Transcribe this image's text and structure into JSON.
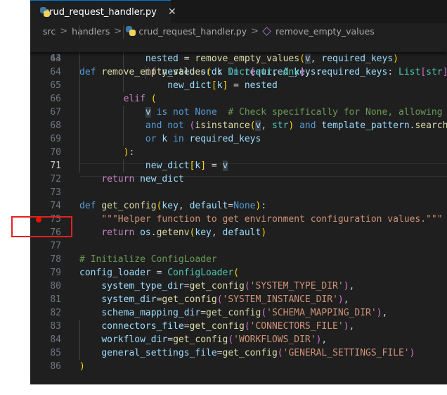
{
  "tab": {
    "filename": "crud_request_handler.py",
    "close": "✕"
  },
  "breadcrumb": {
    "root": "src",
    "folder": "handlers",
    "file": "crud_request_handler.py",
    "symbol": "remove_empty_values",
    "sep": ">"
  },
  "sticky": {
    "ln": "44",
    "def": "def ",
    "fn": "remove_empty_values",
    "rest": [
      {
        "t": "(",
        "c": "br"
      },
      {
        "t": "d",
        "c": "vr"
      },
      {
        "t": ": ",
        "c": ""
      },
      {
        "t": "Dict",
        "c": "ty"
      },
      {
        "t": "[",
        "c": "br2"
      },
      {
        "t": "str",
        "c": "ty"
      },
      {
        "t": ", ",
        "c": ""
      },
      {
        "t": "Any",
        "c": "ty"
      },
      {
        "t": "]",
        "c": "br2"
      },
      {
        "t": ", ",
        "c": ""
      },
      {
        "t": "required_keys",
        "c": "vr"
      },
      {
        "t": ": ",
        "c": ""
      },
      {
        "t": "List",
        "c": "ty"
      },
      {
        "t": "[",
        "c": "br2"
      },
      {
        "t": "str",
        "c": "ty"
      },
      {
        "t": "])",
        "c": "br2"
      }
    ]
  },
  "lines": [
    {
      "n": "63",
      "tokens": [
        {
          "t": "            nested ",
          "c": "vr"
        },
        {
          "t": "= ",
          "c": ""
        },
        {
          "t": "remove_empty_values",
          "c": "fn"
        },
        {
          "t": "(",
          "c": "br"
        },
        {
          "t": "v",
          "c": "vr hl"
        },
        {
          "t": ", ",
          "c": ""
        },
        {
          "t": "required_keys",
          "c": "vr"
        },
        {
          "t": ")",
          "c": "br"
        }
      ]
    },
    {
      "n": "64",
      "tokens": [
        {
          "t": "            ",
          "c": ""
        },
        {
          "t": "if ",
          "c": "ct"
        },
        {
          "t": "nested ",
          "c": "vr"
        },
        {
          "t": "or ",
          "c": "kw"
        },
        {
          "t": "k ",
          "c": "vr"
        },
        {
          "t": "in ",
          "c": "kw"
        },
        {
          "t": "required_keys",
          "c": "vr"
        },
        {
          "t": ":",
          "c": ""
        }
      ]
    },
    {
      "n": "65",
      "tokens": [
        {
          "t": "                ",
          "c": ""
        },
        {
          "t": "new_dict",
          "c": "vr"
        },
        {
          "t": "[",
          "c": "br"
        },
        {
          "t": "k",
          "c": "vr"
        },
        {
          "t": "] ",
          "c": "br"
        },
        {
          "t": "= ",
          "c": ""
        },
        {
          "t": "nested",
          "c": "vr"
        }
      ]
    },
    {
      "n": "66",
      "tokens": [
        {
          "t": "        ",
          "c": ""
        },
        {
          "t": "elif ",
          "c": "ct"
        },
        {
          "t": "(",
          "c": "br"
        }
      ]
    },
    {
      "n": "67",
      "tokens": [
        {
          "t": "            ",
          "c": ""
        },
        {
          "t": "v",
          "c": "vr hl"
        },
        {
          "t": " is not ",
          "c": "kw"
        },
        {
          "t": "None",
          "c": "kw"
        },
        {
          "t": "  # Check specifically for None, allowing T",
          "c": "cm"
        }
      ]
    },
    {
      "n": "68",
      "tokens": [
        {
          "t": "            ",
          "c": ""
        },
        {
          "t": "and not ",
          "c": "kw"
        },
        {
          "t": "(",
          "c": "br2"
        },
        {
          "t": "isinstance",
          "c": "fn"
        },
        {
          "t": "(",
          "c": "br"
        },
        {
          "t": "v",
          "c": "vr hl"
        },
        {
          "t": ", ",
          "c": ""
        },
        {
          "t": "str",
          "c": "ty"
        },
        {
          "t": ") ",
          "c": "br"
        },
        {
          "t": "and ",
          "c": "kw"
        },
        {
          "t": "template_pattern",
          "c": "vr"
        },
        {
          "t": ".",
          "c": ""
        },
        {
          "t": "search",
          "c": "fn"
        },
        {
          "t": "(",
          "c": "br"
        }
      ]
    },
    {
      "n": "69",
      "tokens": [
        {
          "t": "            ",
          "c": ""
        },
        {
          "t": "or ",
          "c": "kw"
        },
        {
          "t": "k ",
          "c": "vr"
        },
        {
          "t": "in ",
          "c": "kw"
        },
        {
          "t": "required_keys",
          "c": "vr"
        }
      ]
    },
    {
      "n": "70",
      "tokens": [
        {
          "t": "        ",
          "c": ""
        },
        {
          "t": ")",
          "c": "br"
        },
        {
          "t": ":",
          "c": ""
        }
      ]
    },
    {
      "n": "71",
      "active": true,
      "tokens": [
        {
          "t": "            ",
          "c": ""
        },
        {
          "t": "new_dict",
          "c": "vr"
        },
        {
          "t": "[",
          "c": "br"
        },
        {
          "t": "k",
          "c": "vr"
        },
        {
          "t": "] ",
          "c": "br"
        },
        {
          "t": "= ",
          "c": ""
        },
        {
          "t": "v",
          "c": "vr hl"
        }
      ]
    },
    {
      "n": "72",
      "tokens": [
        {
          "t": "    ",
          "c": ""
        },
        {
          "t": "return ",
          "c": "ct"
        },
        {
          "t": "new_dict",
          "c": "vr"
        }
      ]
    },
    {
      "n": "73",
      "tokens": []
    },
    {
      "n": "74",
      "tokens": [
        {
          "t": "def ",
          "c": "kw"
        },
        {
          "t": "get_config",
          "c": "fn"
        },
        {
          "t": "(",
          "c": "br"
        },
        {
          "t": "key",
          "c": "vr"
        },
        {
          "t": ", ",
          "c": ""
        },
        {
          "t": "default",
          "c": "vr"
        },
        {
          "t": "=",
          "c": ""
        },
        {
          "t": "None",
          "c": "kw"
        },
        {
          "t": ")",
          "c": "br"
        },
        {
          "t": ":",
          "c": ""
        }
      ]
    },
    {
      "n": "75",
      "breakpoint": true,
      "tokens": [
        {
          "t": "    ",
          "c": ""
        },
        {
          "t": "\"\"\"Helper function to get environment configuration values.\"\"\"",
          "c": "st"
        }
      ]
    },
    {
      "n": "76",
      "tokens": [
        {
          "t": "    ",
          "c": ""
        },
        {
          "t": "return ",
          "c": "ct"
        },
        {
          "t": "os",
          "c": "vr"
        },
        {
          "t": ".",
          "c": ""
        },
        {
          "t": "getenv",
          "c": "fn"
        },
        {
          "t": "(",
          "c": "br"
        },
        {
          "t": "key",
          "c": "vr"
        },
        {
          "t": ", ",
          "c": ""
        },
        {
          "t": "default",
          "c": "vr"
        },
        {
          "t": ")",
          "c": "br"
        }
      ]
    },
    {
      "n": "77",
      "tokens": []
    },
    {
      "n": "78",
      "tokens": [
        {
          "t": "# Initialize ConfigLoader",
          "c": "cm"
        }
      ]
    },
    {
      "n": "79",
      "tokens": [
        {
          "t": "config_loader ",
          "c": "vr"
        },
        {
          "t": "= ",
          "c": ""
        },
        {
          "t": "ConfigLoader",
          "c": "ty"
        },
        {
          "t": "(",
          "c": "br"
        }
      ]
    },
    {
      "n": "80",
      "tokens": [
        {
          "t": "    ",
          "c": ""
        },
        {
          "t": "system_type_dir",
          "c": "vr"
        },
        {
          "t": "=",
          "c": ""
        },
        {
          "t": "get_config",
          "c": "fn"
        },
        {
          "t": "(",
          "c": "br2"
        },
        {
          "t": "'SYSTEM_TYPE_DIR'",
          "c": "st"
        },
        {
          "t": ")",
          "c": "br2"
        },
        {
          "t": ",",
          "c": ""
        }
      ]
    },
    {
      "n": "81",
      "tokens": [
        {
          "t": "    ",
          "c": ""
        },
        {
          "t": "system_dir",
          "c": "vr"
        },
        {
          "t": "=",
          "c": ""
        },
        {
          "t": "get_config",
          "c": "fn"
        },
        {
          "t": "(",
          "c": "br2"
        },
        {
          "t": "'SYSTEM_INSTANCE_DIR'",
          "c": "st"
        },
        {
          "t": ")",
          "c": "br2"
        },
        {
          "t": ",",
          "c": ""
        }
      ]
    },
    {
      "n": "82",
      "tokens": [
        {
          "t": "    ",
          "c": ""
        },
        {
          "t": "schema_mapping_dir",
          "c": "vr"
        },
        {
          "t": "=",
          "c": ""
        },
        {
          "t": "get_config",
          "c": "fn"
        },
        {
          "t": "(",
          "c": "br2"
        },
        {
          "t": "'SCHEMA_MAPPING_DIR'",
          "c": "st"
        },
        {
          "t": ")",
          "c": "br2"
        },
        {
          "t": ",",
          "c": ""
        }
      ]
    },
    {
      "n": "83",
      "tokens": [
        {
          "t": "    ",
          "c": ""
        },
        {
          "t": "connectors_file",
          "c": "vr"
        },
        {
          "t": "=",
          "c": ""
        },
        {
          "t": "get_config",
          "c": "fn"
        },
        {
          "t": "(",
          "c": "br2"
        },
        {
          "t": "'CONNECTORS_FILE'",
          "c": "st"
        },
        {
          "t": ")",
          "c": "br2"
        },
        {
          "t": ",",
          "c": ""
        }
      ]
    },
    {
      "n": "84",
      "tokens": [
        {
          "t": "    ",
          "c": ""
        },
        {
          "t": "workflow_dir",
          "c": "vr"
        },
        {
          "t": "=",
          "c": ""
        },
        {
          "t": "get_config",
          "c": "fn"
        },
        {
          "t": "(",
          "c": "br2"
        },
        {
          "t": "'WORKFLOWS_DIR'",
          "c": "st"
        },
        {
          "t": ")",
          "c": "br2"
        },
        {
          "t": ",",
          "c": ""
        }
      ]
    },
    {
      "n": "85",
      "tokens": [
        {
          "t": "    ",
          "c": ""
        },
        {
          "t": "general_settings_file",
          "c": "vr"
        },
        {
          "t": "=",
          "c": ""
        },
        {
          "t": "get_config",
          "c": "fn"
        },
        {
          "t": "(",
          "c": "br2"
        },
        {
          "t": "'GENERAL_SETTINGS_FILE'",
          "c": "st"
        },
        {
          "t": ")",
          "c": "br2"
        }
      ]
    },
    {
      "n": "86",
      "tokens": [
        {
          "t": ")",
          "c": "br"
        }
      ]
    }
  ]
}
